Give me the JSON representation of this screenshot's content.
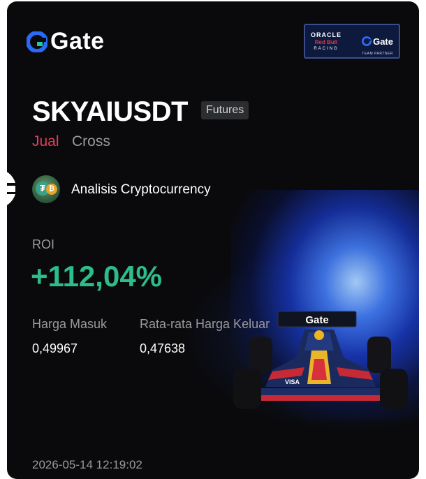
{
  "brand": {
    "name": "Gate",
    "accent": "#2b6af6"
  },
  "partner": {
    "oracle": "ORACLE",
    "redbull": "Red Bull",
    "racing": "RACING",
    "gate": "Gate",
    "team": "TEAM PARTNER"
  },
  "trade": {
    "pair": "SKYAIUSDT",
    "type_badge": "Futures",
    "side": "Jual",
    "margin_mode": "Cross"
  },
  "account": {
    "name": "Analisis Cryptocurrency",
    "avatar_icon": "tether-bitcoin-avatar"
  },
  "roi": {
    "label": "ROI",
    "value": "+112,04%"
  },
  "prices": {
    "entry_label": "Harga Masuk",
    "entry_value": "0,49967",
    "exit_label": "Rata-rata Harga Keluar",
    "exit_value": "0,47638"
  },
  "car_livery": {
    "sponsor": "Gate",
    "visa": "VISA"
  },
  "timestamp": "2026-05-14 12:19:02",
  "colors": {
    "positive": "#2dbd8a",
    "sell": "#e53e5a",
    "muted": "#9a9a9a",
    "background": "#0a0a0c"
  }
}
